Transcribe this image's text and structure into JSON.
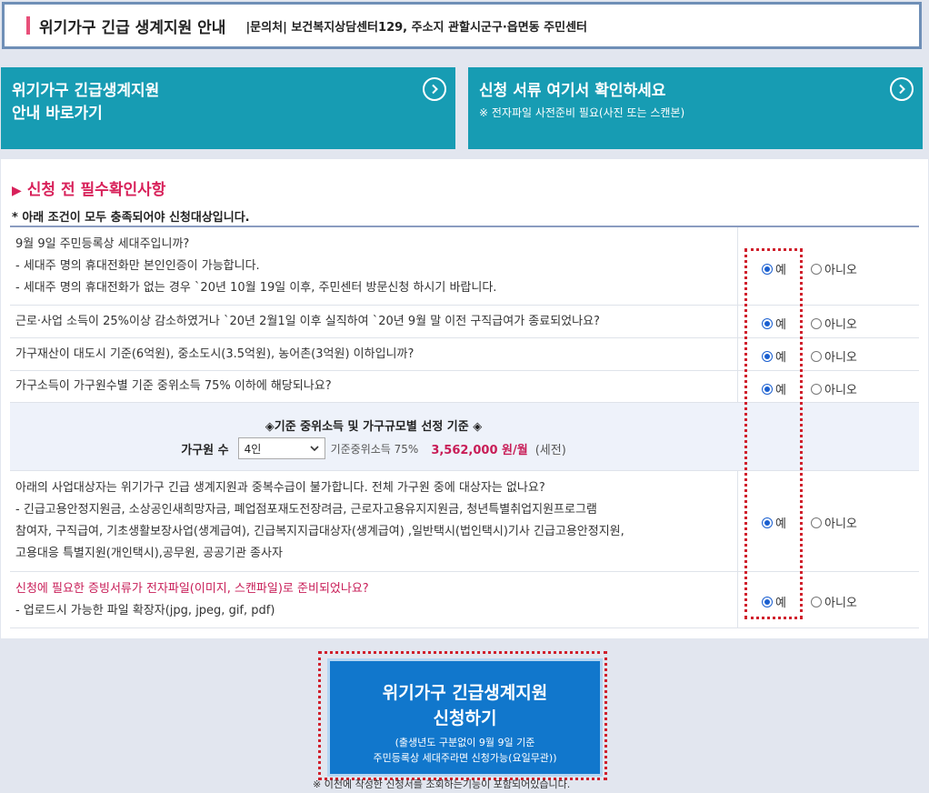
{
  "header": {
    "title": "위기가구 긴급 생계지원 안내",
    "contact": "|문의처| 보건복지상담센터129, 주소지 관할시군구·읍면동 주민센터"
  },
  "tiles": [
    {
      "title_line1": "위기가구 긴급생계지원",
      "title_line2": "안내 바로가기",
      "sub": ""
    },
    {
      "title_line1": "신청 서류 여기서 확인하세요",
      "title_line2": "",
      "sub": "※ 전자파일 사전준비 필요(사진 또는 스캔본)"
    }
  ],
  "section": {
    "title": "신청 전 필수확인사항",
    "notice": "* 아래 조건이 모두 충족되어야 신청대상입니다."
  },
  "options": {
    "yes": "예",
    "no": "아니오"
  },
  "questions": [
    {
      "lines": [
        "9월 9일 주민등록상 세대주입니까?",
        "- 세대주 명의 휴대전화만 본인인증이 가능합니다.",
        "- 세대주 명의 휴대전화가 없는 경우 `20년 10월 19일 이후, 주민센터 방문신청 하시기 바랍니다."
      ],
      "selected": "yes"
    },
    {
      "lines": [
        "근로·사업 소득이 25%이상 감소하였거나 `20년 2월1일 이후 실직하여 `20년 9월 말 이전 구직급여가 종료되었나요?"
      ],
      "selected": "yes"
    },
    {
      "lines": [
        "가구재산이 대도시 기준(6억원), 중소도시(3.5억원), 농어촌(3억원) 이하입니까?"
      ],
      "selected": "yes"
    },
    {
      "lines": [
        "가구소득이 가구원수별 기준 중위소득 75% 이하에 해당되나요?"
      ],
      "selected": "yes"
    },
    {
      "lines": [
        "아래의 사업대상자는 위기가구 긴급 생계지원과 중복수급이 불가합니다. 전체 가구원 중에 대상자는 없나요?",
        "- 긴급고용안정지원금, 소상공인새희망자금, 폐업점포재도전장려금, 근로자고용유지지원금, 청년특별취업지원프로그램",
        "참여자, 구직급여, 기초생활보장사업(생계급여), 긴급복지지급대상자(생계급여) ,일반택시(법인택시)기사 긴급고용안정지원,",
        "고용대응 특별지원(개인택시),공무원, 공공기관 종사자"
      ],
      "selected": "yes"
    },
    {
      "lines": [
        "신청에 필요한 증빙서류가 전자파일(이미지, 스캔파일)로 준비되었나요?",
        "- 업로드시 가능한 파일 확장자(jpg, jpeg, gif, pdf)"
      ],
      "selected": "yes"
    }
  ],
  "criteria": {
    "title": "◈기준 중위소득 및 가구규모별 선정 기준 ◈",
    "household_label": "가구원 수",
    "household_value": "4인",
    "standard_label": "기준중위소득 75%",
    "amount": "3,562,000 원/월",
    "note": "(세전)"
  },
  "apply": {
    "title_line1": "위기가구 긴급생계지원",
    "title_line2": "신청하기",
    "sub_line1": "(출생년도 구분없이 9월 9일 기준",
    "sub_line2": "주민등록상 세대주라면 신청가능(요일무관))",
    "footnote": "※ 이전에 작성한 신청서를 조회하는기능이 포함되어있습니다."
  },
  "colors": {
    "teal": "#179cb3",
    "accent_red": "#d8215a",
    "apply_blue": "#1177cc"
  }
}
